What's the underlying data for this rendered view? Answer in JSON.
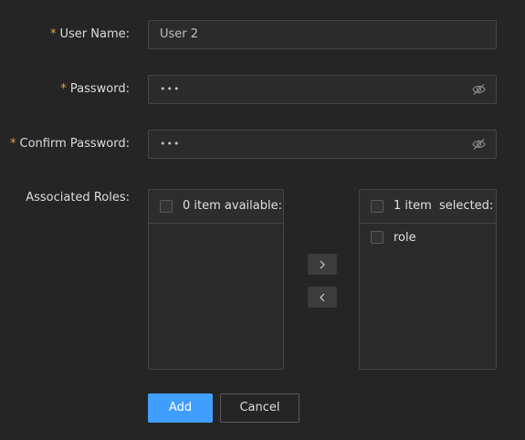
{
  "form": {
    "username": {
      "label": "User Name",
      "required": "*",
      "colon": ":",
      "value": "User 2"
    },
    "password": {
      "label": "Password",
      "required": "*",
      "colon": ":",
      "value": "•••",
      "icon": "eye-off-icon"
    },
    "confirm_password": {
      "label": "Confirm Password",
      "required": "*",
      "colon": ":",
      "value": "•••",
      "icon": "eye-off-icon"
    },
    "roles": {
      "label": "Associated Roles",
      "colon": ":",
      "available": {
        "header": "0 item available:",
        "items": []
      },
      "selected": {
        "header": "1 item  selected:",
        "items": [
          {
            "label": "role"
          }
        ]
      },
      "move_right_icon": "chevron-right-icon",
      "move_left_icon": "chevron-left-icon"
    }
  },
  "actions": {
    "add_label": "Add",
    "cancel_label": "Cancel"
  },
  "colors": {
    "primary": "#409eff",
    "required": "#e6a23c",
    "background": "#252525"
  }
}
